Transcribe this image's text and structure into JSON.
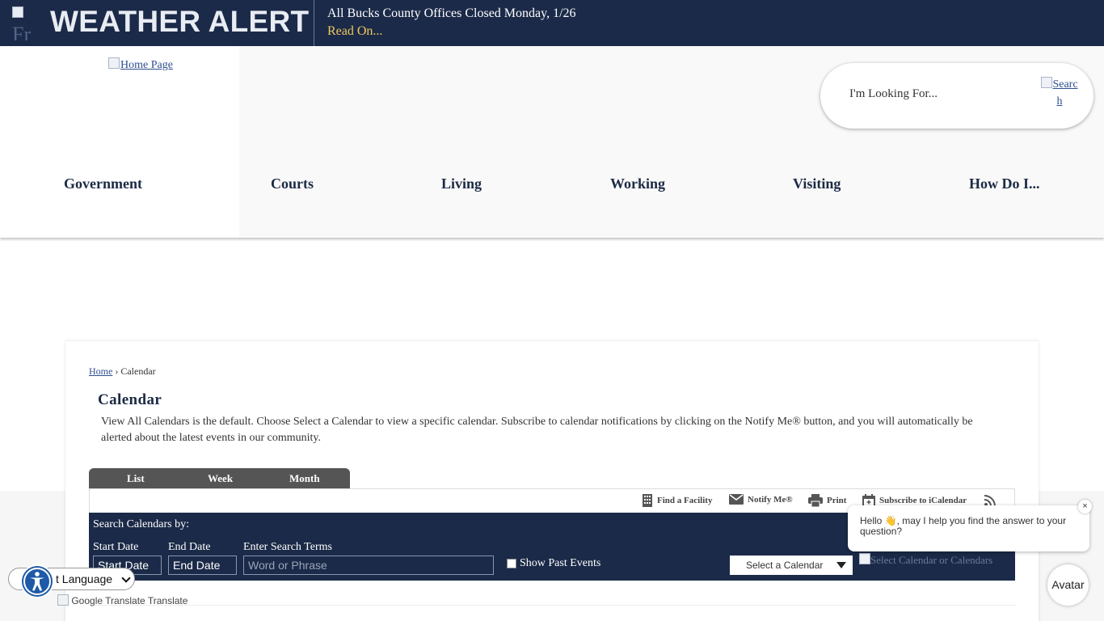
{
  "alert": {
    "image_alt": "Fr",
    "title": "WEATHER ALERT",
    "message": "All Bucks County Offices Closed Monday, 1/26",
    "link": "Read On..."
  },
  "header": {
    "logo_alt": "Home Page",
    "search_placeholder": "I'm Looking For...",
    "search_button_alt": "Search"
  },
  "nav": {
    "items": [
      "Government",
      "Courts",
      "Living",
      "Working",
      "Visiting",
      "How Do I..."
    ]
  },
  "breadcrumb": {
    "home": "Home",
    "separator": "›",
    "current": "Calendar"
  },
  "page": {
    "title": "Calendar",
    "intro": "View All Calendars is the default. Choose Select a Calendar to view a specific calendar. Subscribe to calendar notifications by clicking on the Notify Me® button, and you will automatically be alerted about the latest events in our community."
  },
  "view_tabs": [
    "List",
    "Week",
    "Month"
  ],
  "toolbar": {
    "find_facility": "Find a Facility",
    "notify_me": "Notify Me®",
    "print": "Print",
    "subscribe": "Subscribe to iCalendar"
  },
  "search_panel": {
    "heading": "Search Calendars by:",
    "start_label": "Start Date",
    "start_value": "Start Date",
    "end_label": "End Date",
    "end_value": "End Date",
    "terms_label": "Enter Search Terms",
    "terms_placeholder": "Word or Phrase",
    "past_events": "Show Past Events",
    "select_calendar": "Select a Calendar",
    "select_image_alt": "Select Calendar or Calendars"
  },
  "translate": {
    "label": "t Language",
    "powered_alt": "Google Translate",
    "powered_text": "Translate"
  },
  "chat": {
    "message": "Hello 👋, may I help you find the answer to your question?",
    "close": "×",
    "avatar": "Avatar"
  },
  "colors": {
    "navy": "#1b2a48",
    "alert_link": "#f0c860",
    "tab_gray": "#555555",
    "accessibility_blue": "#1e5aa8"
  }
}
